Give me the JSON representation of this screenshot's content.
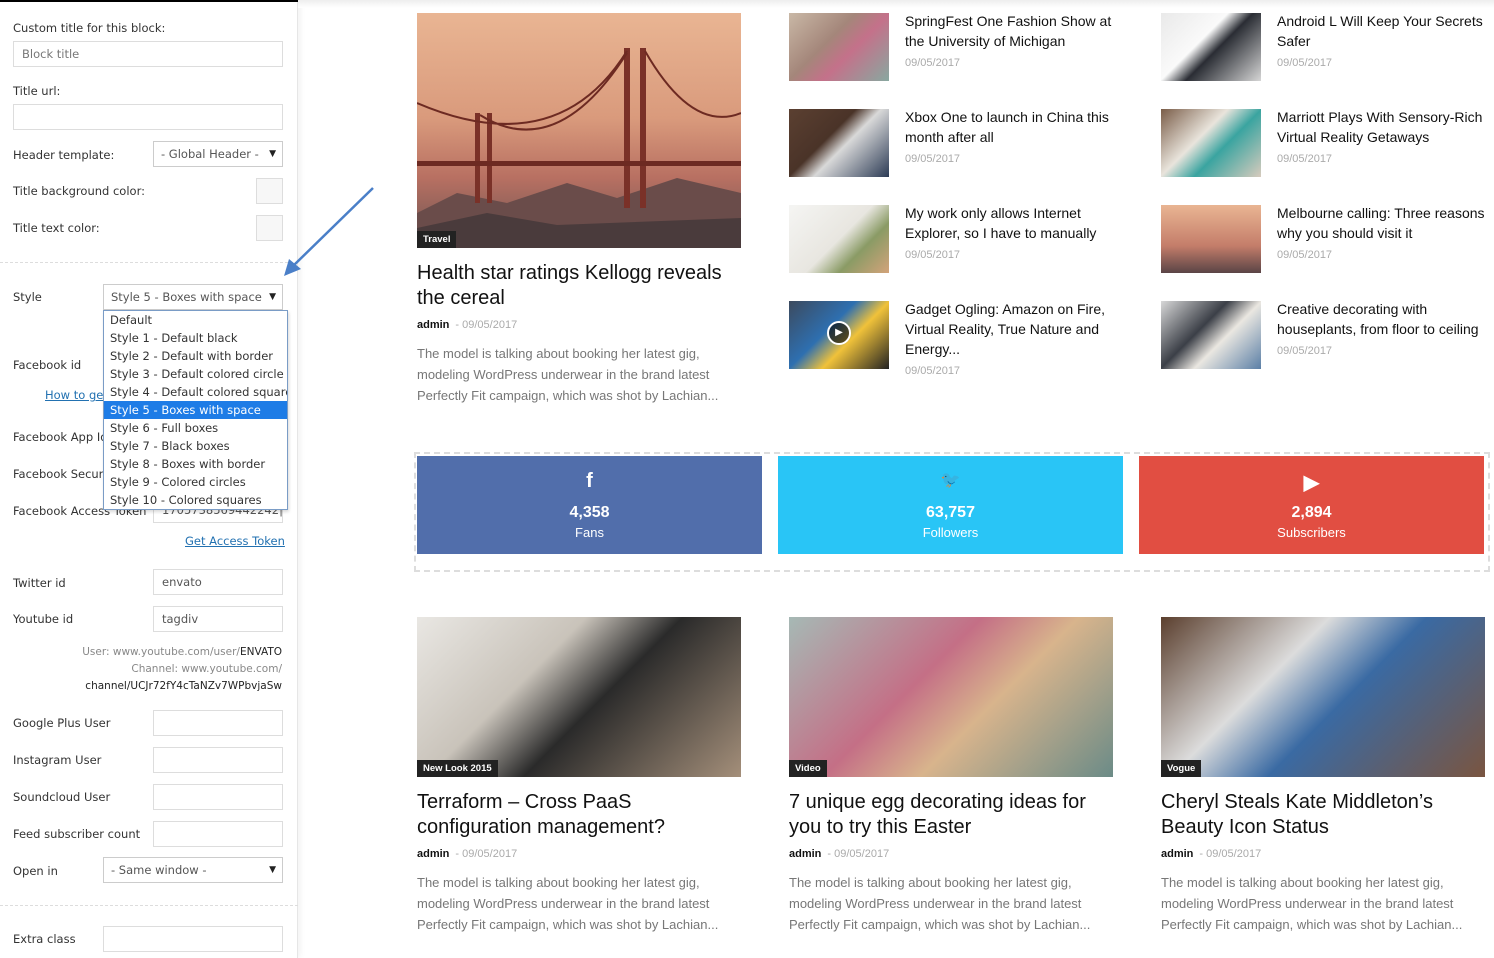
{
  "panel": {
    "custom_title_label": "Custom title for this block:",
    "custom_title_placeholder": "Block title",
    "title_url_label": "Title url:",
    "header_template_label": "Header template:",
    "header_template_value": "- Global Header -",
    "title_bg_label": "Title background color:",
    "title_text_label": "Title text color:",
    "style_label": "Style",
    "style_value": "Style 5 - Boxes with space",
    "style_options": [
      "Default",
      "Style 1 - Default black",
      "Style 2 - Default with border",
      "Style 3 - Default colored circle",
      "Style 4 - Default colored square",
      "Style 5 - Boxes with space",
      "Style 6 - Full boxes",
      "Style 7 - Black boxes",
      "Style 8 - Boxes with border",
      "Style 9 - Colored circles",
      "Style 10 - Colored squares"
    ],
    "style_selected_index": 5,
    "facebook_id_label": "Facebook id",
    "how_to_get_link": "How to get",
    "facebook_app_label": "Facebook App Id",
    "facebook_secret_label": "Facebook Security Key",
    "facebook_token_label": "Facebook Access Token",
    "facebook_token_value": "1705738569442242|",
    "get_access_token": "Get Access Token",
    "twitter_label": "Twitter id",
    "twitter_value": "envato",
    "youtube_label": "Youtube id",
    "youtube_value": "tagdiv",
    "yt_hint1_pre": "User: www.youtube.com/user/",
    "yt_hint1_val": "ENVATO",
    "yt_hint2": "Channel: www.youtube.com/",
    "yt_hint3": "channel/UCJr72fY4cTaNZv7WPbvjaSw",
    "google_label": "Google Plus User",
    "instagram_label": "Instagram User",
    "soundcloud_label": "Soundcloud User",
    "feed_label": "Feed subscriber count",
    "open_in_label": "Open in",
    "open_in_value": "- Same window -",
    "extra_class_label": "Extra class"
  },
  "featured": {
    "category": "Travel",
    "title": "Health star ratings Kellogg reveals the cereal",
    "author": "admin",
    "date": "09/05/2017",
    "excerpt": "The model is talking about booking her latest gig, modeling WordPress underwear in the brand latest Perfectly Fit campaign, which was shot by Lachian..."
  },
  "small_posts": [
    {
      "title": "SpringFest One Fashion Show at the University of Michigan",
      "date": "09/05/2017",
      "thumb": "bike"
    },
    {
      "title": "Android L Will Keep Your Secrets Safer",
      "date": "09/05/2017",
      "thumb": "tablet"
    },
    {
      "title": "Xbox One to launch in China this month after all",
      "date": "09/05/2017",
      "thumb": "desk"
    },
    {
      "title": "Marriott Plays With Sensory-Rich Virtual Reality Getaways",
      "date": "09/05/2017",
      "thumb": "coffee"
    },
    {
      "title": "My work only allows Internet Explorer, so I have to manually",
      "date": "09/05/2017",
      "thumb": "plants"
    },
    {
      "title": "Melbourne calling: Three reasons why you should visit it",
      "date": "09/05/2017",
      "thumb": "bridge"
    },
    {
      "title": "Gadget Ogling: Amazon on Fire, Virtual Reality, True Nature and Energy...",
      "date": "09/05/2017",
      "thumb": "video"
    },
    {
      "title": "Creative decorating with houseplants, from floor to ceiling",
      "date": "09/05/2017",
      "thumb": "laptop"
    }
  ],
  "social": [
    {
      "icon": "facebook-icon",
      "glyph": "f",
      "count": "4,358",
      "unit": "Fans",
      "color": "#516eab"
    },
    {
      "icon": "twitter-icon",
      "glyph": "🐦",
      "count": "63,757",
      "unit": "Followers",
      "color": "#29c5f6"
    },
    {
      "icon": "youtube-icon",
      "glyph": "▶",
      "count": "2,894",
      "unit": "Subscribers",
      "color": "#e14e42"
    }
  ],
  "bottom_posts": [
    {
      "category": "New Look 2015",
      "title": "Terraform – Cross PaaS configuration management?",
      "author": "admin",
      "date": "09/05/2017",
      "excerpt": "The model is talking about booking her latest gig, modeling WordPress underwear in the brand latest Perfectly Fit campaign, which was shot by Lachian..."
    },
    {
      "category": "Video",
      "title": "7 unique egg decorating ideas for you to try this Easter",
      "author": "admin",
      "date": "09/05/2017",
      "excerpt": "The model is talking about booking her latest gig, modeling WordPress underwear in the brand latest Perfectly Fit campaign, which was shot by Lachian..."
    },
    {
      "category": "Vogue",
      "title": "Cheryl Steals Kate Middleton’s Beauty Icon Status",
      "author": "admin",
      "date": "09/05/2017",
      "excerpt": "The model is talking about booking her latest gig, modeling WordPress underwear in the brand latest Perfectly Fit campaign, which was shot by Lachian..."
    }
  ]
}
